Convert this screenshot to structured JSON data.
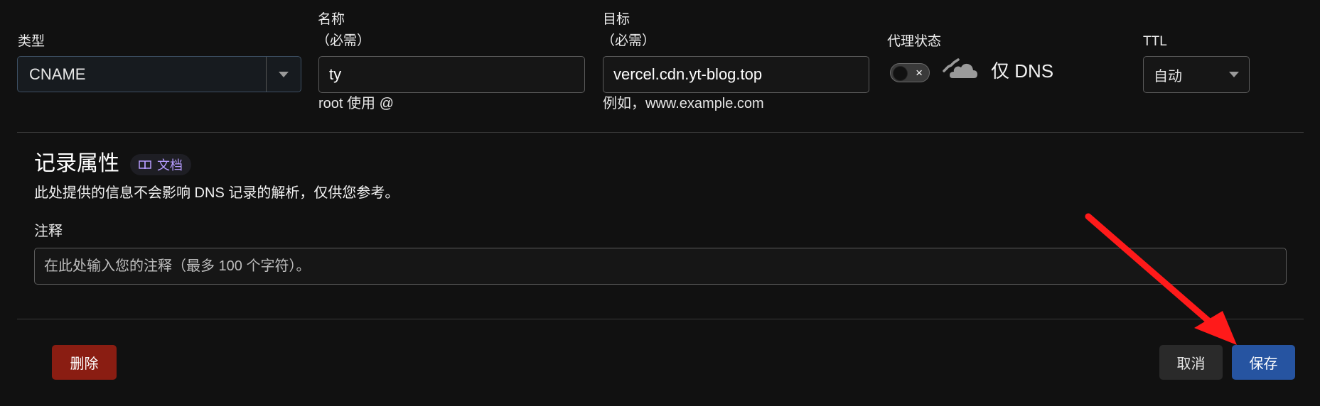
{
  "form": {
    "type": {
      "label": "类型",
      "value": "CNAME"
    },
    "name": {
      "label": "名称",
      "required_note": "（必需）",
      "value": "ty",
      "hint": "root 使用 @"
    },
    "target": {
      "label": "目标",
      "required_note": "（必需）",
      "value": "vercel.cdn.yt-blog.top",
      "hint": "例如，www.example.com"
    },
    "proxy": {
      "label": "代理状态",
      "toggle_symbol": "×",
      "status_text": "仅 DNS",
      "enabled": false
    },
    "ttl": {
      "label": "TTL",
      "value": "自动"
    }
  },
  "record_attributes": {
    "title": "记录属性",
    "doc_link": "文档",
    "description": "此处提供的信息不会影响 DNS 记录的解析，仅供您参考。",
    "comment": {
      "label": "注释",
      "placeholder": "在此处输入您的注释（最多 100 个字符）。"
    }
  },
  "actions": {
    "delete_label": "删除",
    "cancel_label": "取消",
    "save_label": "保存"
  },
  "colors": {
    "background": "#111111",
    "delete": "#8a1d12",
    "save": "#2654a1",
    "doc_link": "#b69cff",
    "annotation_arrow": "#ff1a1a"
  }
}
